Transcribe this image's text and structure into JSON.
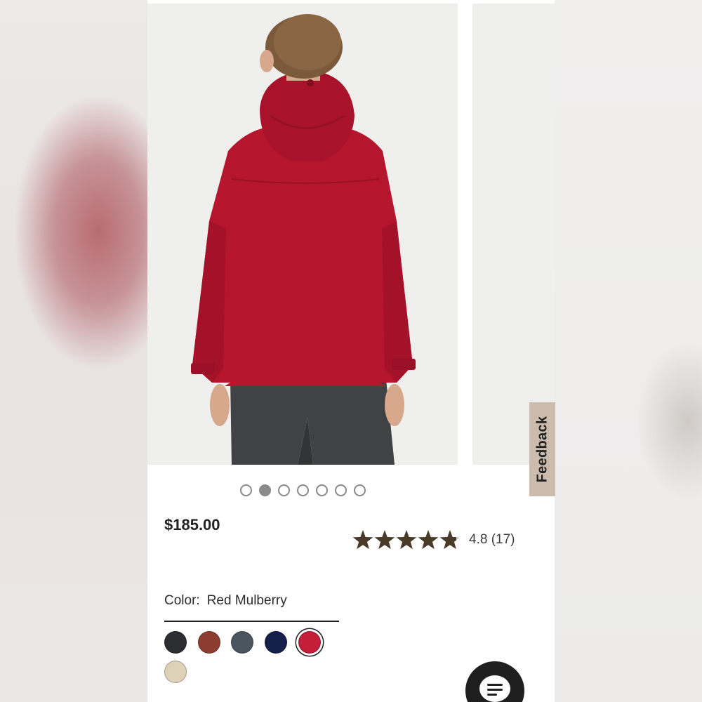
{
  "product": {
    "price": "$185.00",
    "rating_value": 4.8,
    "rating_text": "4.8 (17)",
    "image_count": 7,
    "active_image": 2
  },
  "color": {
    "label": "Color:",
    "selected_name": "Red Mulberry",
    "swatches": [
      {
        "name": "black",
        "hex": "#2b2d31"
      },
      {
        "name": "rust",
        "hex": "#8c3d30"
      },
      {
        "name": "slate",
        "hex": "#4a5560"
      },
      {
        "name": "navy",
        "hex": "#14204a"
      },
      {
        "name": "red-mulberry",
        "hex": "#c41e3a",
        "selected": true
      },
      {
        "name": "sand",
        "hex": "#ddd1b7"
      }
    ]
  },
  "feedback": {
    "label": "Feedback"
  },
  "colors": {
    "star": "#4a3a28",
    "jacket": "#b5152d"
  },
  "icons": {
    "chat": "chat-bubble-icon",
    "star": "star-icon"
  }
}
